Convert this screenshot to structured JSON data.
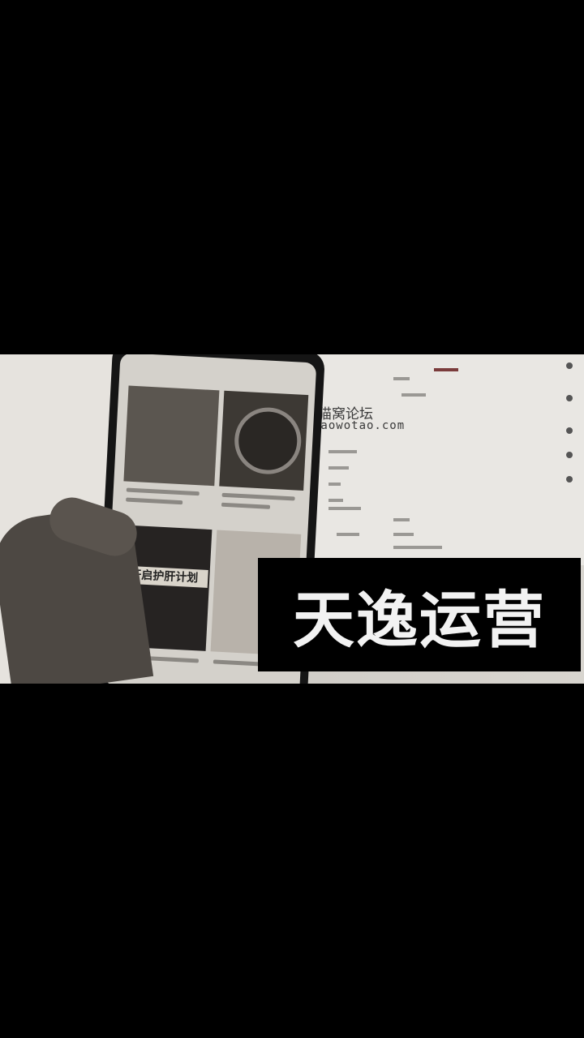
{
  "photo": {
    "forum_title": "猫窝论坛",
    "forum_url": "maowotao.com",
    "phone_banner": "开启护肝计划"
  },
  "overlay": {
    "text": "天逸运营"
  }
}
